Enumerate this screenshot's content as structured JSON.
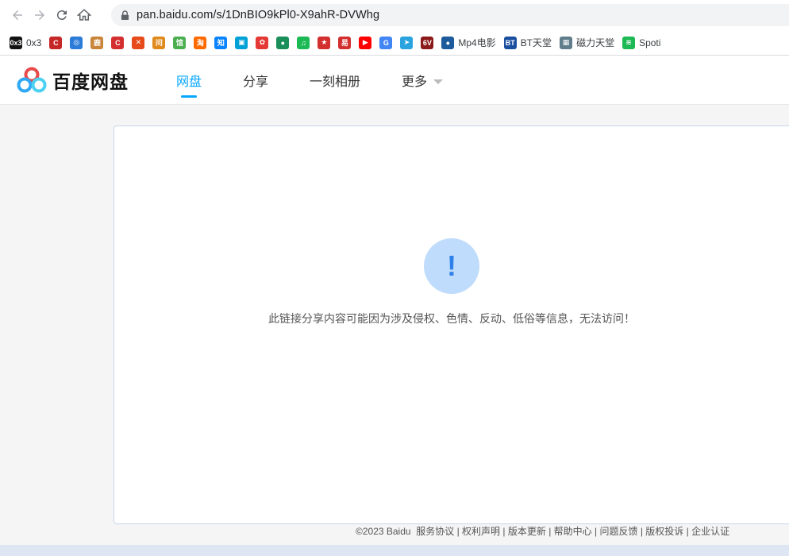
{
  "browser": {
    "url": "pan.baidu.com/s/1DnBIO9kPl0-X9ahR-DVWhg"
  },
  "bookmarks": [
    {
      "icon": "0x3-icon",
      "label": "0x3",
      "color": "#111111",
      "glyph": "0x3"
    },
    {
      "icon": "c-logo-icon",
      "label": "",
      "color": "#c62828",
      "glyph": "C"
    },
    {
      "icon": "globe-icon",
      "label": "",
      "color": "#2b7bd8",
      "glyph": "◎"
    },
    {
      "icon": "deer-icon",
      "label": "",
      "color": "#c9853a",
      "glyph": "鹿"
    },
    {
      "icon": "c-red-icon",
      "label": "",
      "color": "#d32f2f",
      "glyph": "C"
    },
    {
      "icon": "cross-icon",
      "label": "",
      "color": "#e64a19",
      "glyph": "✕"
    },
    {
      "icon": "wen-icon",
      "label": "",
      "color": "#e08a1e",
      "glyph": "问"
    },
    {
      "icon": "guan-icon",
      "label": "",
      "color": "#4caf50",
      "glyph": "馆"
    },
    {
      "icon": "taobao-icon",
      "label": "",
      "color": "#ff6a00",
      "glyph": "淘"
    },
    {
      "icon": "zhihu-icon",
      "label": "",
      "color": "#0a84ff",
      "glyph": "知"
    },
    {
      "icon": "bilibili-icon",
      "label": "",
      "color": "#00a1d6",
      "glyph": "▣"
    },
    {
      "icon": "huawei-icon",
      "label": "",
      "color": "#e53935",
      "glyph": "✿"
    },
    {
      "icon": "chat-icon",
      "label": "",
      "color": "#1b8f5a",
      "glyph": "●"
    },
    {
      "icon": "music-icon",
      "label": "",
      "color": "#1db954",
      "glyph": "♫"
    },
    {
      "icon": "emblem-icon",
      "label": "",
      "color": "#d32f2f",
      "glyph": "★"
    },
    {
      "icon": "yi-icon",
      "label": "",
      "color": "#d32f2f",
      "glyph": "易"
    },
    {
      "icon": "youtube-icon",
      "label": "",
      "color": "#ff0000",
      "glyph": "▶"
    },
    {
      "icon": "google-icon",
      "label": "",
      "color": "#4285f4",
      "glyph": "G"
    },
    {
      "icon": "telegram-icon",
      "label": "",
      "color": "#2aa3df",
      "glyph": "➤"
    },
    {
      "icon": "6v-icon",
      "label": "",
      "color": "#8b1a1a",
      "glyph": "6V"
    },
    {
      "icon": "mp4-icon",
      "label": "Mp4电影",
      "color": "#1e5b9c",
      "glyph": "●"
    },
    {
      "icon": "bt-icon",
      "label": "BT天堂",
      "color": "#1a4fa0",
      "glyph": "BT"
    },
    {
      "icon": "magnet-icon",
      "label": "磁力天堂",
      "color": "#607d8b",
      "glyph": "▦"
    },
    {
      "icon": "spotify-icon",
      "label": "Spoti",
      "color": "#1db954",
      "glyph": "≋"
    }
  ],
  "header": {
    "logo_text": "百度网盘",
    "nav": [
      {
        "label": "网盘",
        "active": true
      },
      {
        "label": "分享",
        "active": false
      },
      {
        "label": "一刻相册",
        "active": false
      },
      {
        "label": "更多",
        "active": false
      }
    ],
    "accent": "#06a7ff"
  },
  "main": {
    "message": "此链接分享内容可能因为涉及侵权、色情、反动、低俗等信息，无法访问！",
    "warning_icon": "exclamation-icon"
  },
  "footer": {
    "copyright": "©2023 Baidu",
    "links": [
      "服务协议",
      "权利声明",
      "版本更新",
      "帮助中心",
      "问题反馈",
      "版权投诉",
      "企业认证"
    ]
  }
}
